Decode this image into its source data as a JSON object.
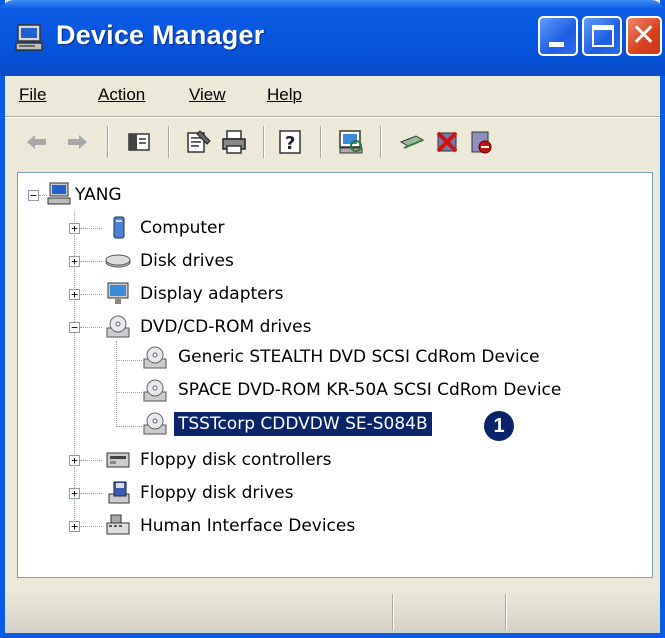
{
  "window": {
    "title": "Device Manager"
  },
  "menu": {
    "file": "File",
    "action": "Action",
    "view": "View",
    "help": "Help"
  },
  "toolbar": {
    "icons": [
      "back-icon",
      "forward-icon",
      "show-hide-console-tree-icon",
      "properties-icon",
      "print-icon",
      "help-icon",
      "scan-hardware-icon",
      "update-driver-icon",
      "uninstall-icon",
      "disable-icon"
    ]
  },
  "tree": {
    "root": "YANG",
    "categories": {
      "computer": "Computer",
      "disk_drives": "Disk drives",
      "display_adapters": "Display adapters",
      "dvd_cdrom": "DVD/CD-ROM drives",
      "floppy_controllers": "Floppy disk controllers",
      "floppy_drives": "Floppy disk drives",
      "hid": "Human Interface Devices"
    },
    "dvd_devices": [
      "Generic STEALTH DVD SCSI CdRom Device",
      "SPACE DVD-ROM KR-50A SCSI CdRom Device",
      "TSSTcorp CDDVDW SE-S084B"
    ],
    "selected_marker": "1"
  },
  "colors": {
    "titlebar": "#0a5be4",
    "selection": "#0a246a",
    "window_bg": "#ece9d8"
  }
}
